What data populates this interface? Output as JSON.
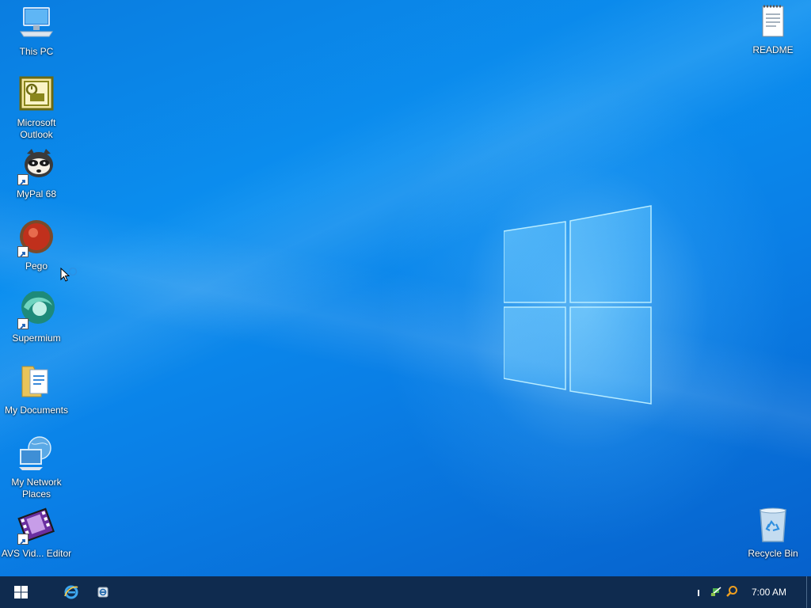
{
  "desktop": {
    "icons": [
      {
        "name": "this-pc",
        "label": "This PC",
        "icon": "computer-icon"
      },
      {
        "name": "microsoft-outlook",
        "label": "Microsoft Outlook",
        "icon": "outlook-icon"
      },
      {
        "name": "mypal-68",
        "label": "MyPal 68",
        "icon": "mypal-raccoon-icon"
      },
      {
        "name": "pego",
        "label": "Pego",
        "icon": "pego-icon"
      },
      {
        "name": "supermium",
        "label": "Supermium",
        "icon": "supermium-icon"
      },
      {
        "name": "my-documents",
        "label": "My Documents",
        "icon": "folder-documents-icon"
      },
      {
        "name": "my-network-places",
        "label": "My Network Places",
        "icon": "network-places-icon"
      },
      {
        "name": "avs-video-editor",
        "label": "AVS Vid... Editor",
        "icon": "avs-film-icon"
      },
      {
        "name": "readme",
        "label": "README",
        "icon": "notepad-file-icon"
      },
      {
        "name": "recycle-bin",
        "label": "Recycle Bin",
        "icon": "recycle-bin-icon"
      }
    ]
  },
  "taskbar": {
    "start_icon": "windows-start-icon",
    "pinned": [
      {
        "name": "internet-explorer",
        "icon": "internet-explorer-icon"
      },
      {
        "name": "app-launcher",
        "icon": "app-gear-icon"
      }
    ],
    "tray": {
      "icons": [
        "network-tray-icon",
        "search-tray-icon"
      ],
      "clock": "7:00 AM"
    }
  },
  "colors": {
    "desktop_blue": "#0a7de0",
    "taskbar": "#0f2b4f"
  }
}
